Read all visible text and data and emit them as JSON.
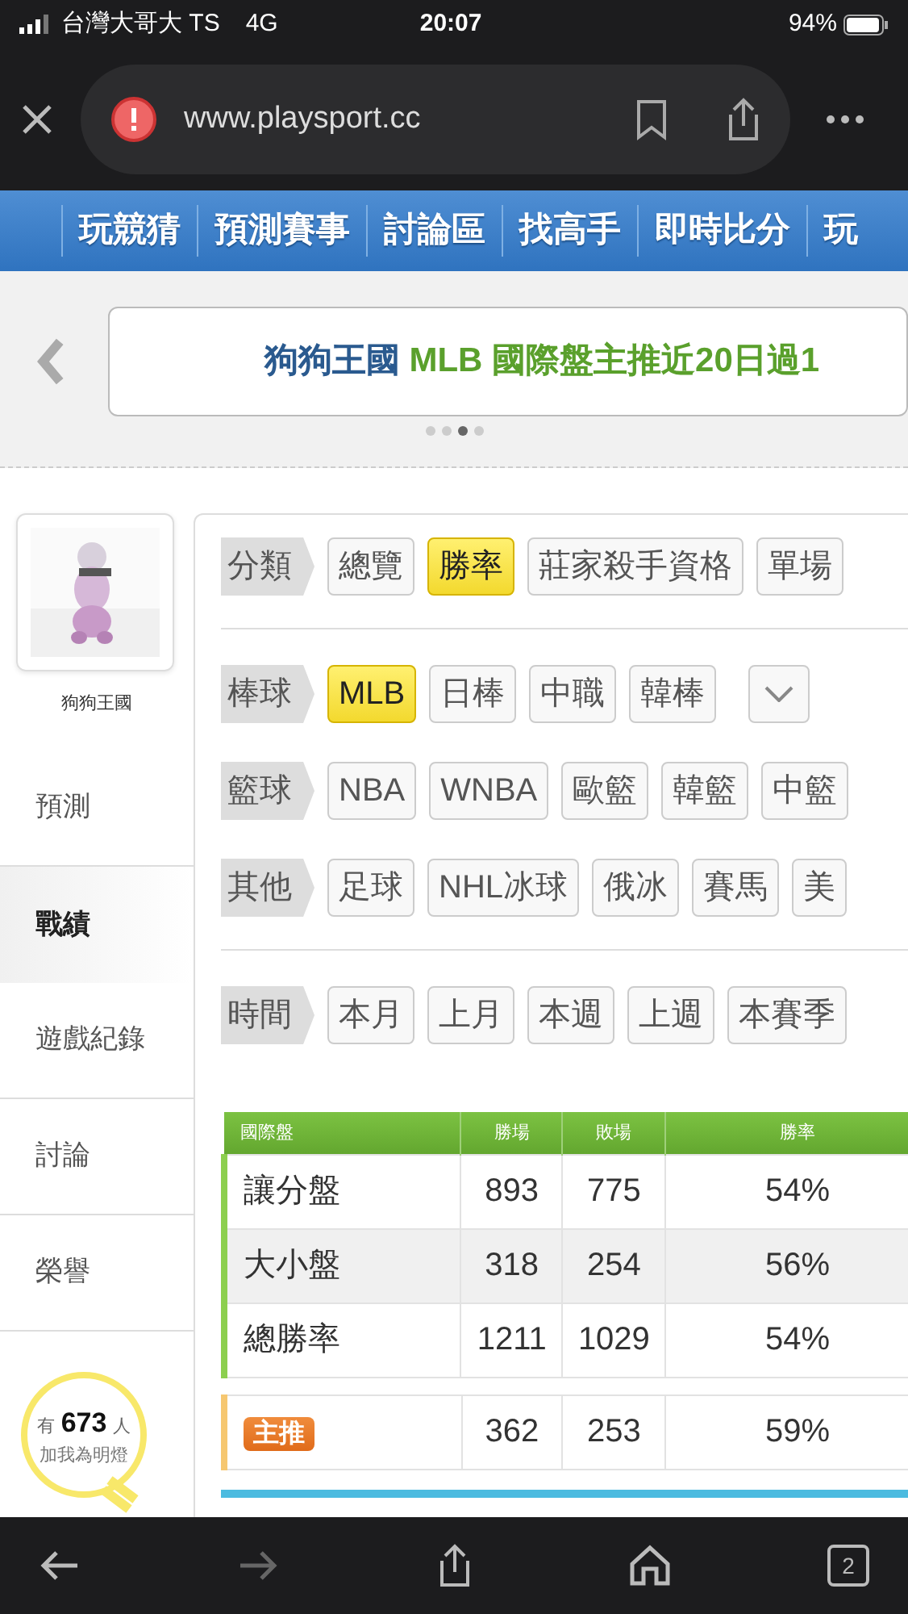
{
  "status_bar": {
    "carrier": "台灣大哥大 TS",
    "network": "4G",
    "time": "20:07",
    "battery": "94%"
  },
  "browser": {
    "url": "www.playsport.cc"
  },
  "nav_items": [
    "玩競猜",
    "預測賽事",
    "討論區",
    "找高手",
    "即時比分",
    "玩"
  ],
  "banner": {
    "name": "狗狗王國",
    "headline": "MLB 國際盤主推近20日過1",
    "slides": [
      {
        "selected": false
      },
      {
        "selected": false
      },
      {
        "selected": true
      },
      {
        "selected": false
      }
    ]
  },
  "sidebar": {
    "profile": {
      "name": "狗狗王國"
    },
    "items": [
      {
        "label": "預測",
        "selected": false
      },
      {
        "label": "戰績",
        "selected": true
      },
      {
        "label": "遊戲紀錄",
        "selected": false
      },
      {
        "label": "討論",
        "selected": false
      },
      {
        "label": "榮譽",
        "selected": false
      }
    ],
    "fans": {
      "prefix": "有",
      "count": "673",
      "suffix": "人",
      "caption": "加我為明燈"
    }
  },
  "filters": [
    {
      "label": "分類",
      "more_button": false,
      "divider_after": true,
      "options": [
        {
          "label": "總覽",
          "selected": false
        },
        {
          "label": "勝率",
          "selected": true
        },
        {
          "label": "莊家殺手資格",
          "selected": false
        },
        {
          "label": "單場",
          "selected": false
        }
      ]
    },
    {
      "label": "棒球",
      "more_button": true,
      "divider_after": false,
      "options": [
        {
          "label": "MLB",
          "selected": true
        },
        {
          "label": "日棒",
          "selected": false
        },
        {
          "label": "中職",
          "selected": false
        },
        {
          "label": "韓棒",
          "selected": false
        }
      ]
    },
    {
      "label": "籃球",
      "more_button": false,
      "divider_after": false,
      "options": [
        {
          "label": "NBA",
          "selected": false
        },
        {
          "label": "WNBA",
          "selected": false
        },
        {
          "label": "歐籃",
          "selected": false
        },
        {
          "label": "韓籃",
          "selected": false
        },
        {
          "label": "中籃",
          "selected": false
        }
      ]
    },
    {
      "label": "其他",
      "more_button": false,
      "divider_after": true,
      "options": [
        {
          "label": "足球",
          "selected": false
        },
        {
          "label": "NHL冰球",
          "selected": false
        },
        {
          "label": "俄冰",
          "selected": false
        },
        {
          "label": "賽馬",
          "selected": false
        },
        {
          "label": "美",
          "selected": false
        }
      ]
    },
    {
      "label": "時間",
      "more_button": false,
      "divider_after": false,
      "options": [
        {
          "label": "本月",
          "selected": false
        },
        {
          "label": "上月",
          "selected": false
        },
        {
          "label": "本週",
          "selected": false
        },
        {
          "label": "上週",
          "selected": false
        },
        {
          "label": "本賽季",
          "selected": false
        }
      ]
    }
  ],
  "table": {
    "columns": [
      "國際盤",
      "勝場",
      "敗場",
      "勝率"
    ],
    "rows": [
      {
        "label": "讓分盤",
        "wins": "893",
        "losses": "775",
        "rate": "54%"
      },
      {
        "label": "大小盤",
        "wins": "318",
        "losses": "254",
        "rate": "56%"
      },
      {
        "label": "總勝率",
        "wins": "1211",
        "losses": "1029",
        "rate": "54%"
      }
    ],
    "featured": {
      "badge": "主推",
      "wins": "362",
      "losses": "253",
      "rate": "59%"
    }
  },
  "toolbar": {
    "tab_count": "2"
  }
}
